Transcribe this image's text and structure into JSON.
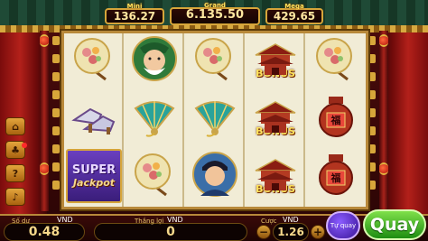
{
  "jackpots": {
    "mini": {
      "tag": "Mini",
      "value": "136.27"
    },
    "grand": {
      "tag": "Grand",
      "value": "6.135.50"
    },
    "mega": {
      "tag": "Mega",
      "value": "429.65"
    }
  },
  "reel_grid": [
    [
      "rose-fan",
      "grandpa",
      "rose-fan",
      "temple-bonus",
      "rose-fan"
    ],
    [
      "shoes",
      "jade-fan",
      "jade-fan",
      "temple-bonus",
      "wine-jar"
    ],
    [
      "super-jackpot",
      "rose-fan",
      "young-man",
      "temple-bonus",
      "wine-jar"
    ]
  ],
  "symbols": {
    "bonus_label": "BONUS",
    "super_label": "SUPER",
    "jackpot_label": "Jackpot",
    "jar_character": "福"
  },
  "side_menu": [
    {
      "icon": "home-icon",
      "glyph": "⌂"
    },
    {
      "icon": "cup-icon",
      "glyph": "♣"
    },
    {
      "icon": "help-icon",
      "glyph": "?"
    },
    {
      "icon": "sound-icon",
      "glyph": "♪"
    }
  ],
  "bottom": {
    "balance_label": "Số dư",
    "balance_unit": "VND",
    "balance_value": "0.48",
    "win_label": "Thắng lợi",
    "win_unit": "VND",
    "win_value": "0",
    "bet_label": "Cược",
    "bet_unit": "VND",
    "bet_value": "1.26",
    "bet_minus": "−",
    "bet_plus": "+",
    "auto_label": "Tự quay",
    "spin_label": "Quay"
  },
  "colors": {
    "accent_gold": "#d6a53a",
    "spin_green": "#1e8d12",
    "auto_purple": "#3a1497"
  }
}
